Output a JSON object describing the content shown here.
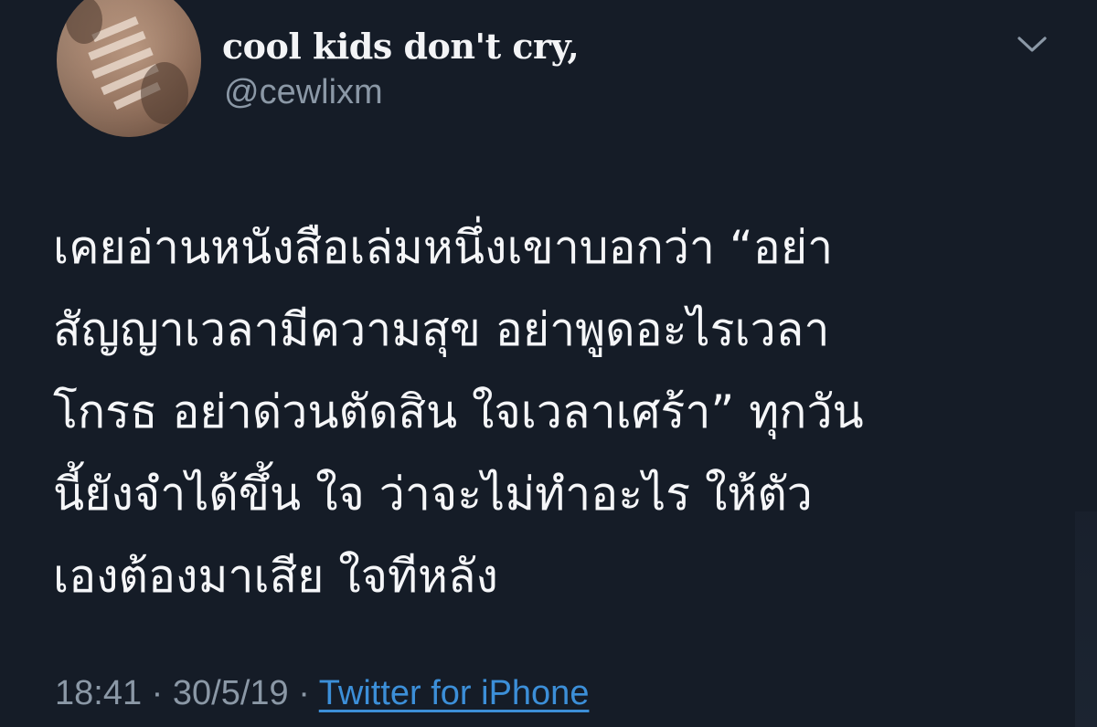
{
  "tweet": {
    "display_name": "cool kids don't cry,",
    "handle": "@cewlixm",
    "text": "เคยอ่านหนังสือเล่มหนึ่งเขาบอกว่า “อย่า\nสัญญาเวลามีความสุข อย่าพูดอะไรเวลา\nโกรธ อย่าด่วนตัดสิน ใจเวลาเศร้า” ทุกวัน\nนี้ยังจำได้ขึ้น ใจ ว่าจะไม่ทำอะไร ให้ตัว\nเองต้องมาเสีย ใจทีหลัง",
    "time": "18:41",
    "separator": "·",
    "date": "30/5/19",
    "source": "Twitter for iPhone"
  },
  "icons": {
    "menu": "chevron-down-icon",
    "avatar": "avatar"
  },
  "colors": {
    "background": "#151c27",
    "text": "#f5f6f8",
    "muted": "#8b98a6",
    "link": "#3c8fd8"
  }
}
